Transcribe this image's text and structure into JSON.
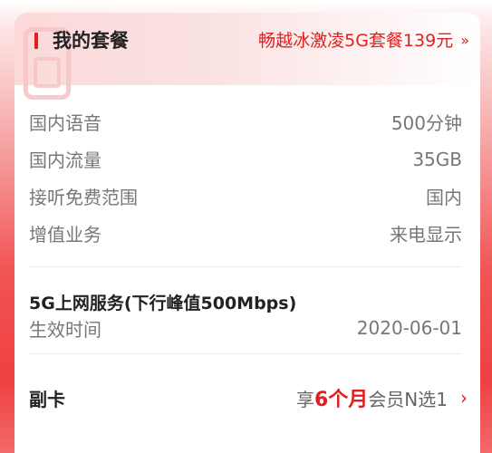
{
  "header": {
    "title": "我的套餐",
    "plan_link": "畅越冰激凌5G套餐139元",
    "link_chevron": "»"
  },
  "details": [
    {
      "label": "国内语音",
      "value": "500分钟"
    },
    {
      "label": "国内流量",
      "value": "35GB"
    },
    {
      "label": "接听免费范围",
      "value": "国内"
    },
    {
      "label": "增值业务",
      "value": "来电显示"
    }
  ],
  "service": {
    "title": "5G上网服务(下行峰值500Mbps)",
    "effective_label": "生效时间",
    "effective_date": "2020-06-01"
  },
  "vice_card": {
    "label": "副卡",
    "promo_prefix": "享",
    "promo_highlight": "6个月",
    "promo_suffix": "会员N选1",
    "arrow": "›"
  },
  "colors": {
    "accent": "#e02020",
    "text_primary": "#222222",
    "text_secondary": "#777777"
  },
  "icons": [
    "sim-card-icon",
    "double-chevron-right-icon",
    "chevron-right-icon"
  ]
}
